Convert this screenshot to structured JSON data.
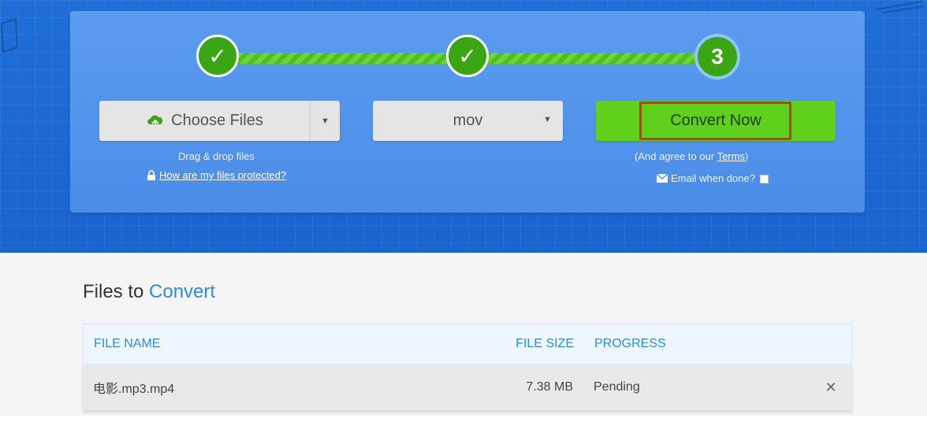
{
  "steps": [
    {
      "state": "done",
      "glyph": "✓"
    },
    {
      "state": "done",
      "glyph": "✓"
    },
    {
      "state": "current",
      "label": "3"
    }
  ],
  "controls": {
    "choose_files_label": "Choose Files",
    "drag_drop_text": "Drag & drop files",
    "protected_link": "How are my files protected?",
    "format_value": "mov",
    "convert_label": "Convert Now",
    "agree_prefix": "(And agree to our ",
    "terms_link": "Terms",
    "agree_suffix": ")",
    "email_label": "Email when done?"
  },
  "files_section": {
    "title_main": "Files to",
    "title_accent": "Convert",
    "columns": [
      "FILE NAME",
      "FILE SIZE",
      "PROGRESS"
    ],
    "rows": [
      {
        "name": "电影.mp3.mp4",
        "size": "7.38 MB",
        "progress": "Pending",
        "remove_glyph": "✕"
      }
    ]
  },
  "colors": {
    "accent_blue": "#2f8ae0",
    "convert_green": "#5fd11c",
    "highlight_red": "#e02a1a"
  }
}
